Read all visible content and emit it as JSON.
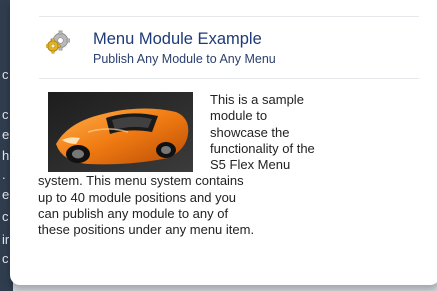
{
  "module": {
    "title": "Menu Module Example",
    "subtitle": "Publish Any Module to Any Menu",
    "icon": "gear-icon",
    "image": "sports-car-image",
    "body_lines_wrapped": [
      "This is a sample",
      "module to",
      "showcase the",
      "functionality of the",
      "S5 Flex Menu"
    ],
    "body_lines_full": [
      "system. This menu system contains",
      "up to 40 module positions and you",
      "can publish any module to any of",
      "these positions under any menu item."
    ]
  },
  "left_strip_chars": [
    "c",
    "c",
    "e",
    "h",
    ".",
    "e",
    "c",
    "ir",
    "c"
  ],
  "colors": {
    "title": "#1d3a77",
    "subtitle": "#2b3f6c",
    "body_text": "#222222",
    "panel_bg": "#ffffff",
    "left_strip": "#2f3d4f",
    "car": "#f07a12"
  }
}
